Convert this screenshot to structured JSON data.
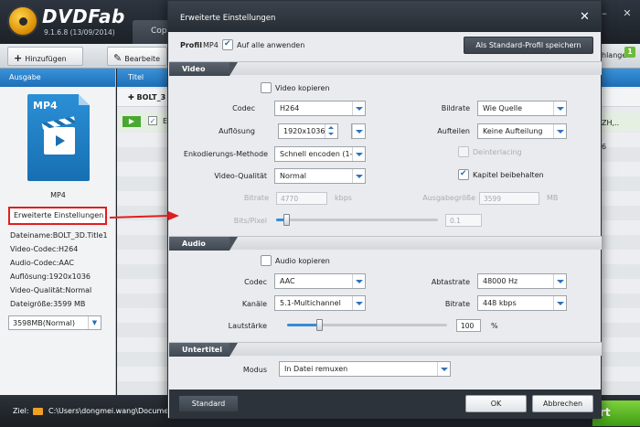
{
  "app": {
    "logo_text": "DVDFab",
    "version": "9.1.6.8 (13/09/2014)",
    "tab_label": "Cop",
    "toolbar": {
      "add_label": "Hinzufügen",
      "edit_label": "Bearbeite",
      "right_label": "hlange",
      "badge": "1"
    },
    "left_panel": {
      "header": "Ausgabe",
      "file_type": "MP4",
      "caption": "MP4",
      "advanced_button": "Erweiterte Einstellungen",
      "info": [
        "Dateiname:BOLT_3D.Title1",
        "Video-Codec:H264",
        "Audio-Codec:AAC",
        "Auflösung:1920x1036",
        "Video-Qualität:Normal",
        "Dateigröße:3599 MB"
      ],
      "size_select": "3598MB(Normal)"
    },
    "mid_panel": {
      "header": "Titel",
      "row1_label": "BOLT_3",
      "row2_label": "E",
      "right_texts": [
        "ZH,..",
        "6"
      ]
    },
    "bottom": {
      "ziel_label": "Ziel:",
      "path": "C:\\Users\\dongmei.wang\\Documen",
      "start_label": "rt"
    }
  },
  "dialog": {
    "title": "Erweiterte Einstellungen",
    "profile_label": "Profil",
    "profile_value": "MP4",
    "apply_all_label": "Auf alle anwenden",
    "apply_all_checked": true,
    "save_default_label": "Als Standard-Profil speichern",
    "sections": {
      "video": "Video",
      "audio": "Audio",
      "subtitle": "Untertitel"
    },
    "video": {
      "copy_label": "Video kopieren",
      "copy_checked": false,
      "codec_label": "Codec",
      "codec_value": "H264",
      "resolution_label": "Auflösung",
      "resolution_value": "1920x1036",
      "encoding_label": "Enkodierungs-Methode",
      "encoding_value": "Schnell encoden (1-p",
      "quality_label": "Video-Qualität",
      "quality_value": "Normal",
      "bitrate_label": "Bitrate",
      "bitrate_value": "4770",
      "bitrate_unit": "kbps",
      "bitspixel_label": "Bits/Pixel",
      "bitspixel_value": "0.1",
      "bitspixel_fraction": 0.06,
      "bildrate_label": "Bildrate",
      "bildrate_value": "Wie Quelle",
      "aufteilen_label": "Aufteilen",
      "aufteilen_value": "Keine Aufteilung",
      "deinterlacing_label": "Deinterlacing",
      "deinterlacing_checked": false,
      "chapters_label": "Kapitel beibehalten",
      "chapters_checked": true,
      "output_size_label": "Ausgabegröße",
      "output_size_value": "3599",
      "output_size_unit": "MB"
    },
    "audio": {
      "copy_label": "Audio kopieren",
      "copy_checked": false,
      "codec_label": "Codec",
      "codec_value": "AAC",
      "channels_label": "Kanäle",
      "channels_value": "5.1-Multichannel",
      "volume_label": "Lautstärke",
      "volume_value": "100",
      "volume_unit": "%",
      "volume_fraction": 0.2,
      "samplerate_label": "Abtastrate",
      "samplerate_value": "48000 Hz",
      "bitrate_label": "Bitrate",
      "bitrate_value": "448 kbps"
    },
    "subtitle": {
      "mode_label": "Modus",
      "mode_value": "In Datei remuxen"
    },
    "buttons": {
      "standard": "Standard",
      "ok": "OK",
      "cancel": "Abbrechen"
    },
    "colors": {
      "accent_blue": "#2f72c0",
      "slider_fill": "#3b8ad4",
      "highlight_red": "#e01e1e"
    }
  }
}
